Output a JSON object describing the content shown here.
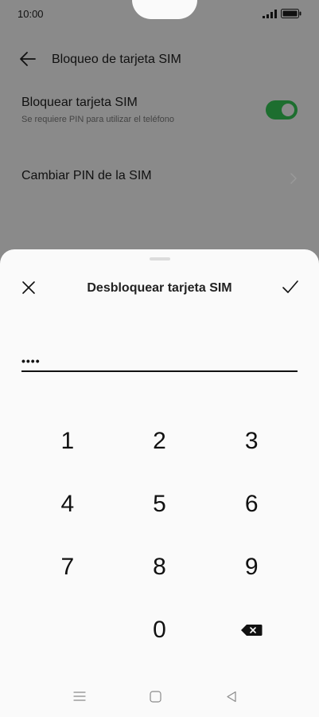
{
  "status_bar": {
    "time": "10:00"
  },
  "header": {
    "title": "Bloqueo de tarjeta SIM"
  },
  "settings": {
    "lock_sim": {
      "title": "Bloquear tarjeta SIM",
      "subtitle": "Se requiere PIN para utilizar el teléfono",
      "enabled": true
    },
    "change_pin": {
      "title": "Cambiar PIN de la SIM"
    }
  },
  "dialog": {
    "title": "Desbloquear tarjeta SIM",
    "pin_value": "••••"
  },
  "keypad": {
    "keys": [
      "1",
      "2",
      "3",
      "4",
      "5",
      "6",
      "7",
      "8",
      "9",
      "",
      "0",
      "⌫"
    ]
  },
  "colors": {
    "toggle_on": "#1d6e2f",
    "dim_overlay": "#8a8a8a"
  }
}
